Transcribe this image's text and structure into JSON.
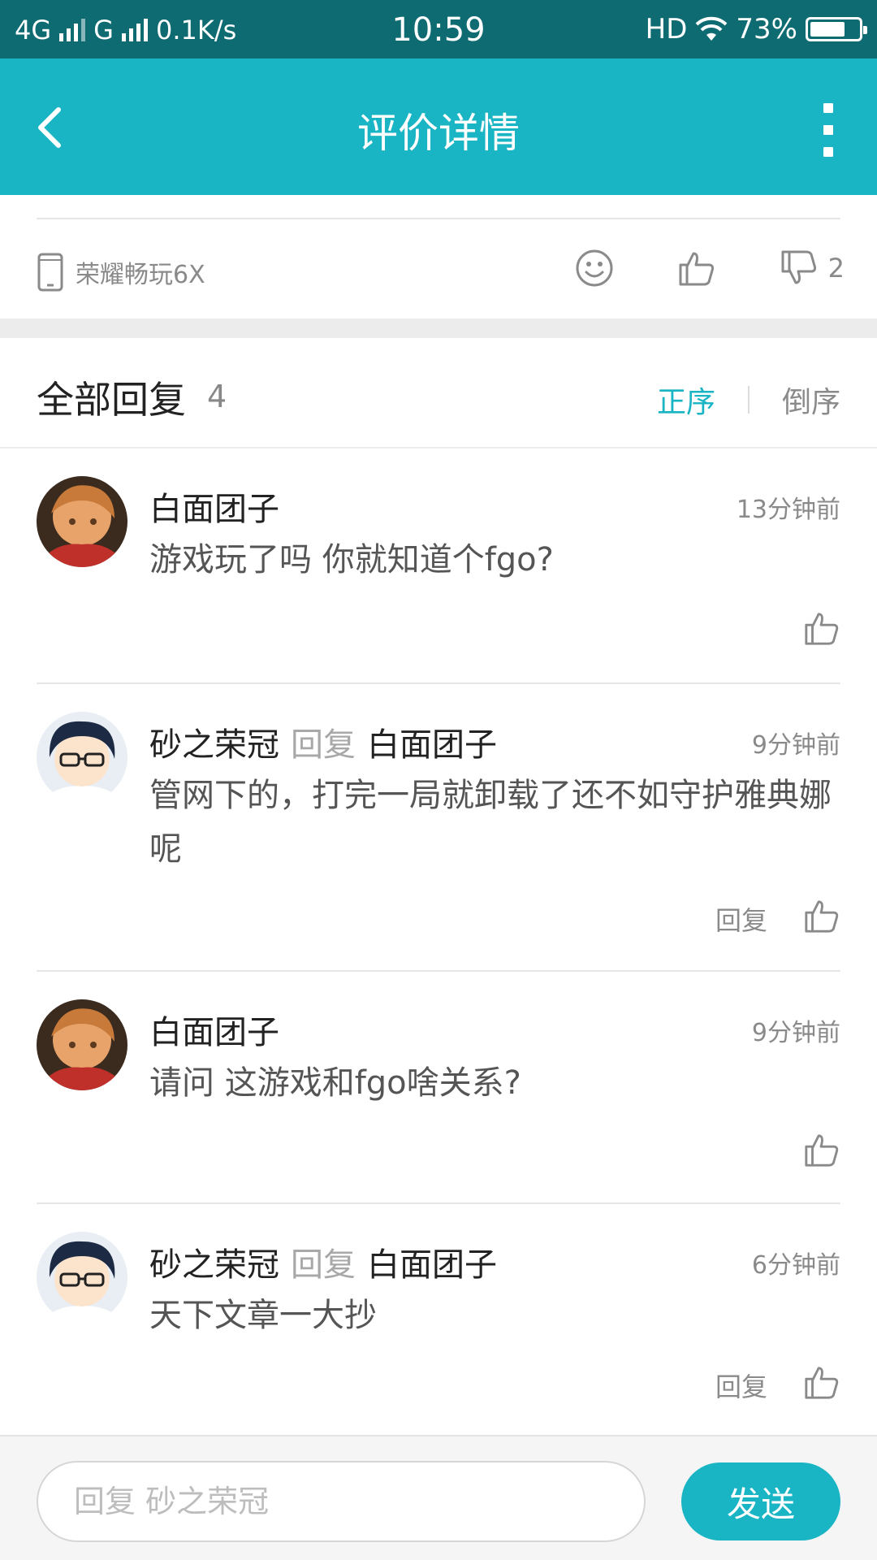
{
  "status_bar": {
    "net1": "4G",
    "net2": "G",
    "speed": "0.1K/s",
    "time": "10:59",
    "hd": "HD",
    "battery_text": "73%",
    "battery_level": 0.73
  },
  "title_bar": {
    "title": "评价详情"
  },
  "device_row": {
    "device_name": "荣耀畅玩6X",
    "dislike_count": "2"
  },
  "replies_header": {
    "title": "全部回复",
    "count": "4",
    "sort_asc": "正序",
    "sort_desc": "倒序"
  },
  "comments": [
    {
      "author": "白面团子",
      "reply_word": "",
      "reply_to": "",
      "time": "13分钟前",
      "text": "游戏玩了吗 你就知道个fgo?",
      "reply_button": ""
    },
    {
      "author": "砂之荣冠",
      "reply_word": "回复",
      "reply_to": "白面团子",
      "time": "9分钟前",
      "text": "管网下的，打完一局就卸载了还不如守护雅典娜呢",
      "reply_button": "回复"
    },
    {
      "author": "白面团子",
      "reply_word": "",
      "reply_to": "",
      "time": "9分钟前",
      "text": "请问 这游戏和fgo啥关系?",
      "reply_button": ""
    },
    {
      "author": "砂之荣冠",
      "reply_word": "回复",
      "reply_to": "白面团子",
      "time": "6分钟前",
      "text": "天下文章一大抄",
      "reply_button": "回复"
    }
  ],
  "input_bar": {
    "placeholder": "回复 砂之荣冠",
    "send": "发送"
  },
  "colors": {
    "accent": "#19b5c4",
    "status_bar": "#0e6b72"
  }
}
